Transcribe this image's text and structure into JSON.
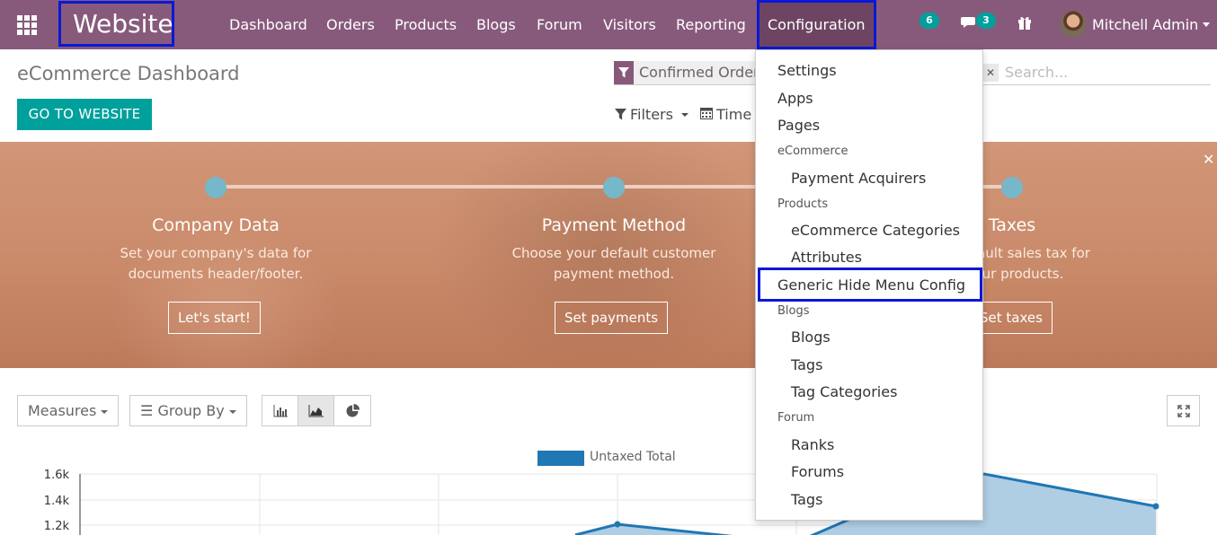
{
  "topbar": {
    "brand": "Website",
    "menu": [
      "Dashboard",
      "Orders",
      "Products",
      "Blogs",
      "Forum",
      "Visitors",
      "Reporting",
      "Configuration"
    ],
    "activity_count": "6",
    "messages_count": "3",
    "user_name": "Mitchell Admin"
  },
  "control_panel": {
    "title": "eCommerce Dashboard",
    "go_button": "GO TO WEBSITE",
    "facet_label": "Confirmed Orders",
    "search_placeholder": "Search...",
    "filters_label": "Filters",
    "time_ranges_label": "Time Ranges"
  },
  "onboarding": {
    "steps": [
      {
        "title": "Company Data",
        "desc1": "Set your company's data for",
        "desc2": "documents header/footer.",
        "button": "Let's start!"
      },
      {
        "title": "Payment Method",
        "desc1": "Choose your default customer",
        "desc2": "payment method.",
        "button": "Set payments"
      },
      {
        "title": "Taxes",
        "desc1": "default sales tax for",
        "desc2": "ur products.",
        "button": "Set taxes"
      }
    ]
  },
  "graph_toolbar": {
    "measures": "Measures",
    "group_by": "Group By"
  },
  "chart_data": {
    "type": "area",
    "series": [
      {
        "name": "Untaxed Total",
        "color": "#1f77b4"
      }
    ],
    "y_ticks": [
      "1.6k",
      "1.4k",
      "1.2k"
    ]
  },
  "config_menu": {
    "items": [
      {
        "kind": "item",
        "label": "Settings"
      },
      {
        "kind": "item",
        "label": "Apps"
      },
      {
        "kind": "item",
        "label": "Pages"
      },
      {
        "kind": "header",
        "label": "eCommerce"
      },
      {
        "kind": "sub",
        "label": "Payment Acquirers"
      },
      {
        "kind": "header",
        "label": "Products"
      },
      {
        "kind": "sub",
        "label": "eCommerce Categories"
      },
      {
        "kind": "sub",
        "label": "Attributes"
      },
      {
        "kind": "item",
        "label": "Generic Hide Menu Config"
      },
      {
        "kind": "header",
        "label": "Blogs"
      },
      {
        "kind": "sub",
        "label": "Blogs"
      },
      {
        "kind": "sub",
        "label": "Tags"
      },
      {
        "kind": "sub",
        "label": "Tag Categories"
      },
      {
        "kind": "header",
        "label": "Forum"
      },
      {
        "kind": "sub",
        "label": "Ranks"
      },
      {
        "kind": "sub",
        "label": "Forums"
      },
      {
        "kind": "sub",
        "label": "Tags"
      }
    ]
  }
}
